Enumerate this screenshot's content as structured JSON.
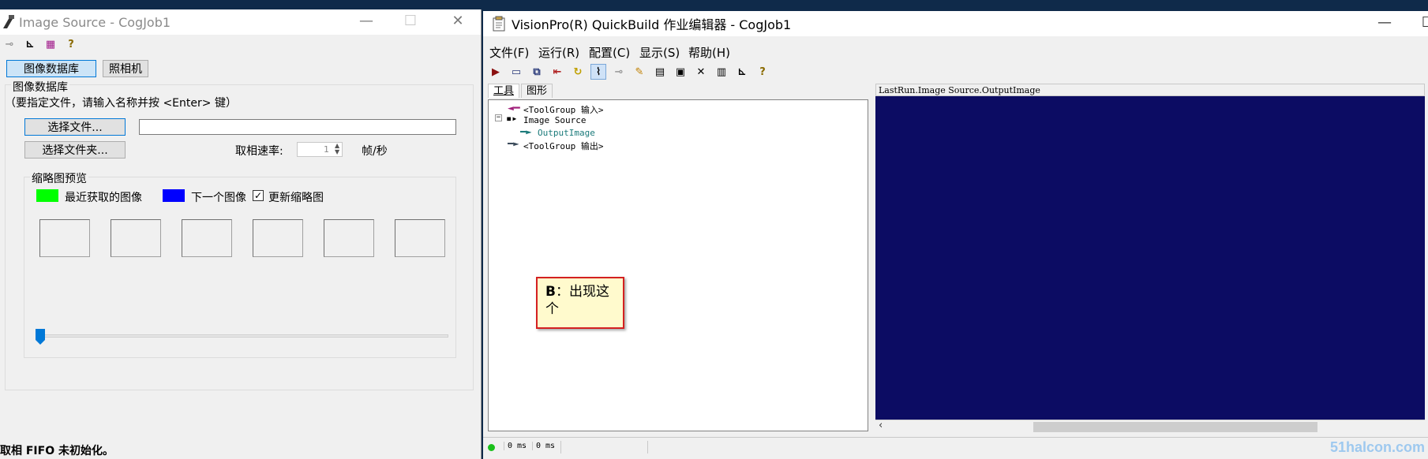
{
  "left_window": {
    "title": "Image Source - CogJob1",
    "toolbar_icons": [
      "pin-icon",
      "ruler-icon",
      "grid-icon",
      "help-icon"
    ],
    "tabs": {
      "database": "图像数据库",
      "camera": "照相机"
    },
    "group_title": "图像数据库",
    "hint": "（要指定文件，请输入名称并按 <Enter> 键）",
    "select_file": "选择文件...",
    "select_folder": "选择文件夹...",
    "file_path": "",
    "rate_label": "取相速率:",
    "rate_value": "1",
    "rate_unit": "帧/秒",
    "preview_title": "缩略图预览",
    "legend_recent": "最近获取的图像",
    "legend_next": "下一个图像",
    "update_thumbs": "更新缩略图",
    "status": "取相 FIFO 未初始化。",
    "colors": {
      "recent": "#00ff00",
      "next": "#0000ff"
    }
  },
  "right_window": {
    "title": "VisionPro(R) QuickBuild 作业编辑器 - CogJob1",
    "menu": [
      "文件(F)",
      "运行(R)",
      "配置(C)",
      "显示(S)",
      "帮助(H)"
    ],
    "tabs": [
      "工具",
      "图形"
    ],
    "tree": {
      "input": "<ToolGroup 输入>",
      "tool": "Image Source",
      "output_image": "OutputImage",
      "output": "<ToolGroup 输出>"
    },
    "image_header": "LastRun.Image Source.OutputImage",
    "status_times": [
      "0 ms",
      "0 ms"
    ],
    "callout_bold": "B",
    "callout_text": "：出现这个",
    "image_bg": "#0c0c63"
  },
  "watermark": "51halcon.com"
}
